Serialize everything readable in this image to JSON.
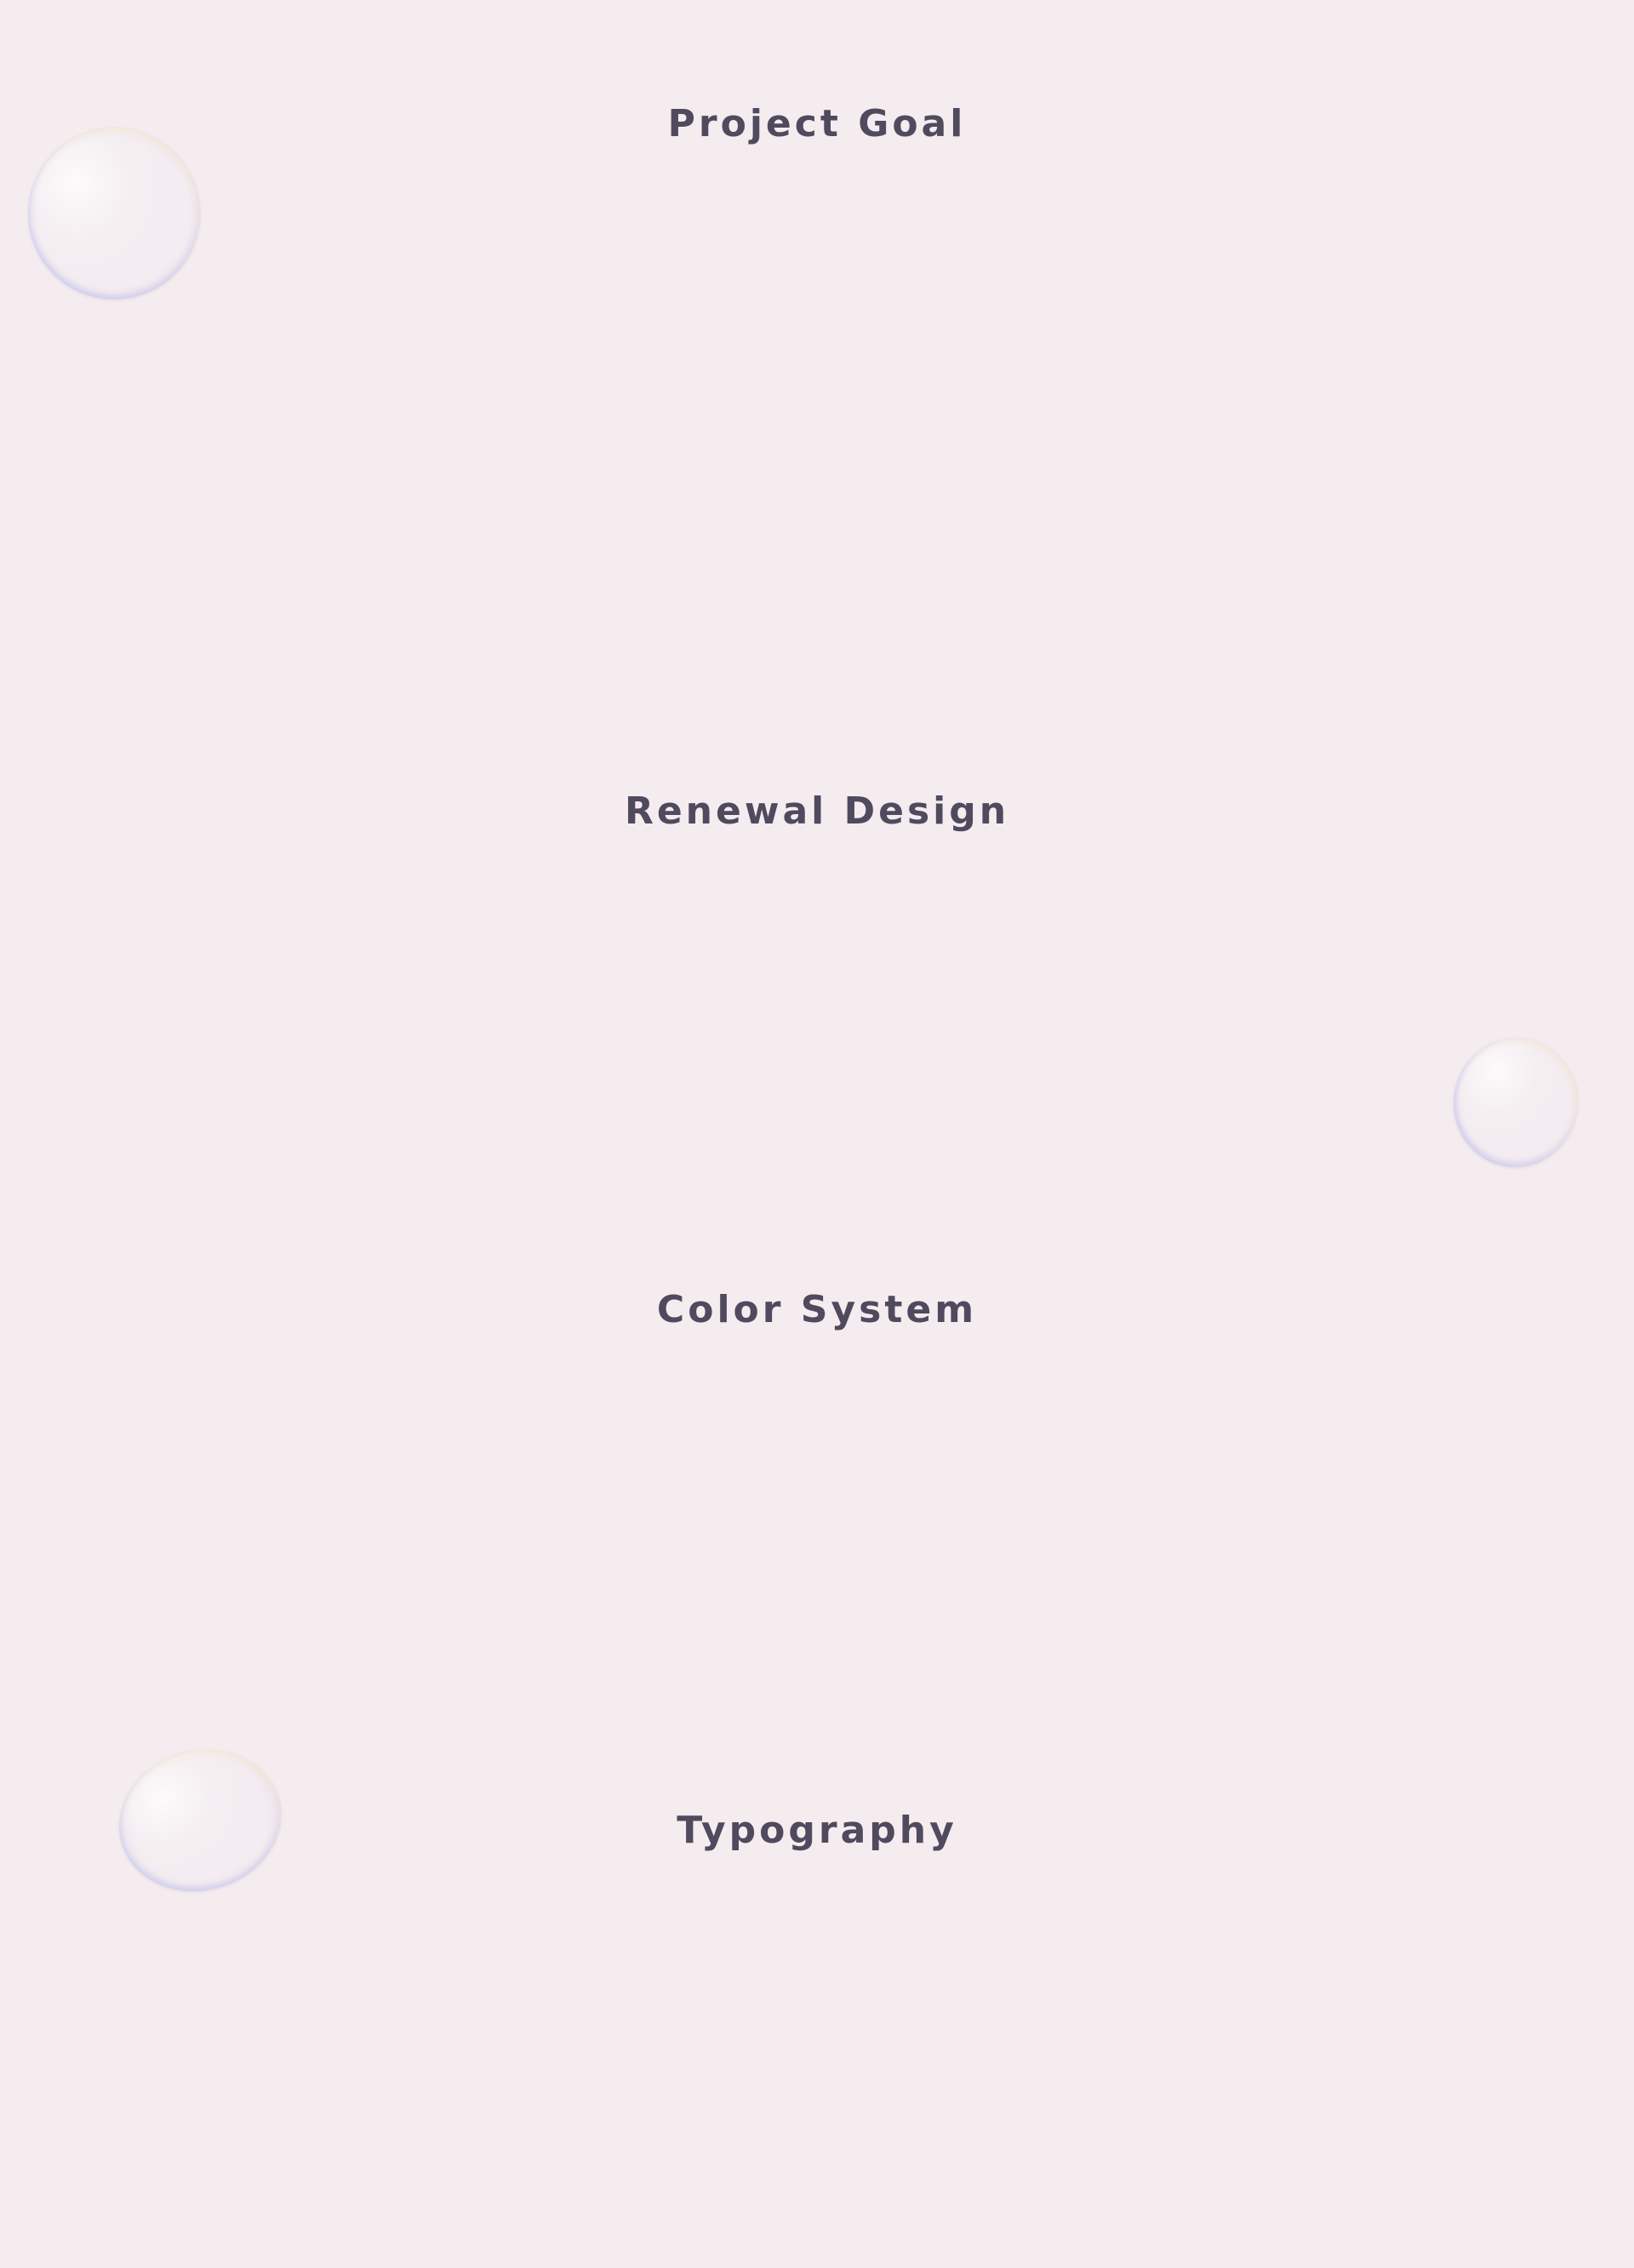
{
  "sections": [
    {
      "title": "Project Goal"
    },
    {
      "title": "Renewal Design"
    },
    {
      "title": "Color System"
    },
    {
      "title": "Typography"
    }
  ],
  "colors": {
    "background": "#f4ecee",
    "heading": "#4f4a5e"
  },
  "decorations": [
    "bubble",
    "bubble",
    "bubble"
  ]
}
